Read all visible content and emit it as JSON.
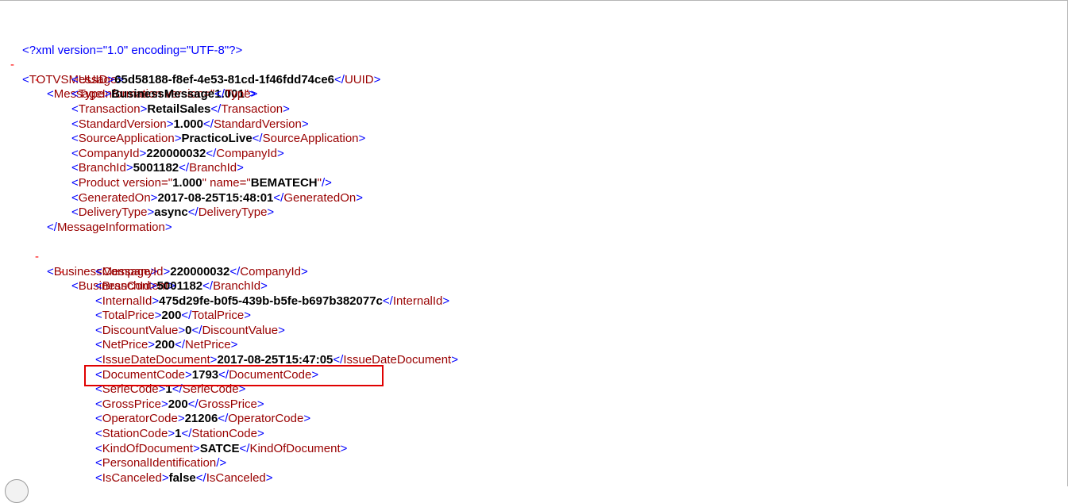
{
  "colors": {
    "bracket": "#0000ff",
    "tag": "#990000",
    "value": "#000000",
    "collapse": "#ff0000",
    "highlight": "#e00000"
  },
  "xml": {
    "declaration": "<?xml version=\"1.0\" encoding=\"UTF-8\"?>",
    "collapse_symbol": "-",
    "lines": [
      {
        "type": "open",
        "tag": "TOTVSMessage"
      },
      {
        "type": "open",
        "tag": "MessageInformation",
        "attr_text": " version=\"",
        "attr_value": "1.001",
        "attr_close": "\""
      },
      {
        "type": "leaf",
        "tag": "UUID",
        "value": "65d58188-f8ef-4e53-81cd-1f46fdd74ce6"
      },
      {
        "type": "leaf",
        "tag": "Type",
        "value": "BusinessMessage"
      },
      {
        "type": "leaf",
        "tag": "Transaction",
        "value": "RetailSales"
      },
      {
        "type": "leaf",
        "tag": "StandardVersion",
        "value": "1.000"
      },
      {
        "type": "leaf",
        "tag": "SourceApplication",
        "value": "PracticoLive"
      },
      {
        "type": "leaf",
        "tag": "CompanyId",
        "value": "220000032"
      },
      {
        "type": "leaf",
        "tag": "BranchId",
        "value": "5001182"
      },
      {
        "type": "product",
        "tag": "Product",
        "attr1": " version=\"",
        "val1": "1.000",
        "attr2": "\" name=\"",
        "val2": "BEMATECH",
        "attr_close": "\""
      },
      {
        "type": "leaf",
        "tag": "GeneratedOn",
        "value": "2017-08-25T15:48:01"
      },
      {
        "type": "leaf",
        "tag": "DeliveryType",
        "value": "async"
      },
      {
        "type": "close",
        "tag": "MessageInformation"
      },
      {
        "type": "open",
        "tag": "BusinessMessage"
      },
      {
        "type": "open",
        "tag": "BusinessContent"
      },
      {
        "type": "leaf",
        "tag": "CompanyId",
        "value": "220000032"
      },
      {
        "type": "leaf",
        "tag": "BranchId",
        "value": "5001182"
      },
      {
        "type": "leaf",
        "tag": "InternalId",
        "value": "475d29fe-b0f5-439b-b5fe-b697b382077c"
      },
      {
        "type": "leaf",
        "tag": "TotalPrice",
        "value": "200"
      },
      {
        "type": "leaf",
        "tag": "DiscountValue",
        "value": "0"
      },
      {
        "type": "leaf",
        "tag": "NetPrice",
        "value": "200"
      },
      {
        "type": "leaf",
        "tag": "IssueDateDocument",
        "value": "2017-08-25T15:47:05"
      },
      {
        "type": "leaf",
        "tag": "DocumentCode",
        "value": "1793"
      },
      {
        "type": "leaf",
        "tag": "SerieCode",
        "value": "1"
      },
      {
        "type": "leaf",
        "tag": "GrossPrice",
        "value": "200"
      },
      {
        "type": "leaf",
        "tag": "OperatorCode",
        "value": "21206"
      },
      {
        "type": "leaf",
        "tag": "StationCode",
        "value": "1"
      },
      {
        "type": "leaf",
        "tag": "KindOfDocument",
        "value": "SATCE"
      },
      {
        "type": "empty",
        "tag": "PersonalIdentification"
      },
      {
        "type": "leaf",
        "tag": "IsCanceled",
        "value": "false"
      }
    ]
  }
}
